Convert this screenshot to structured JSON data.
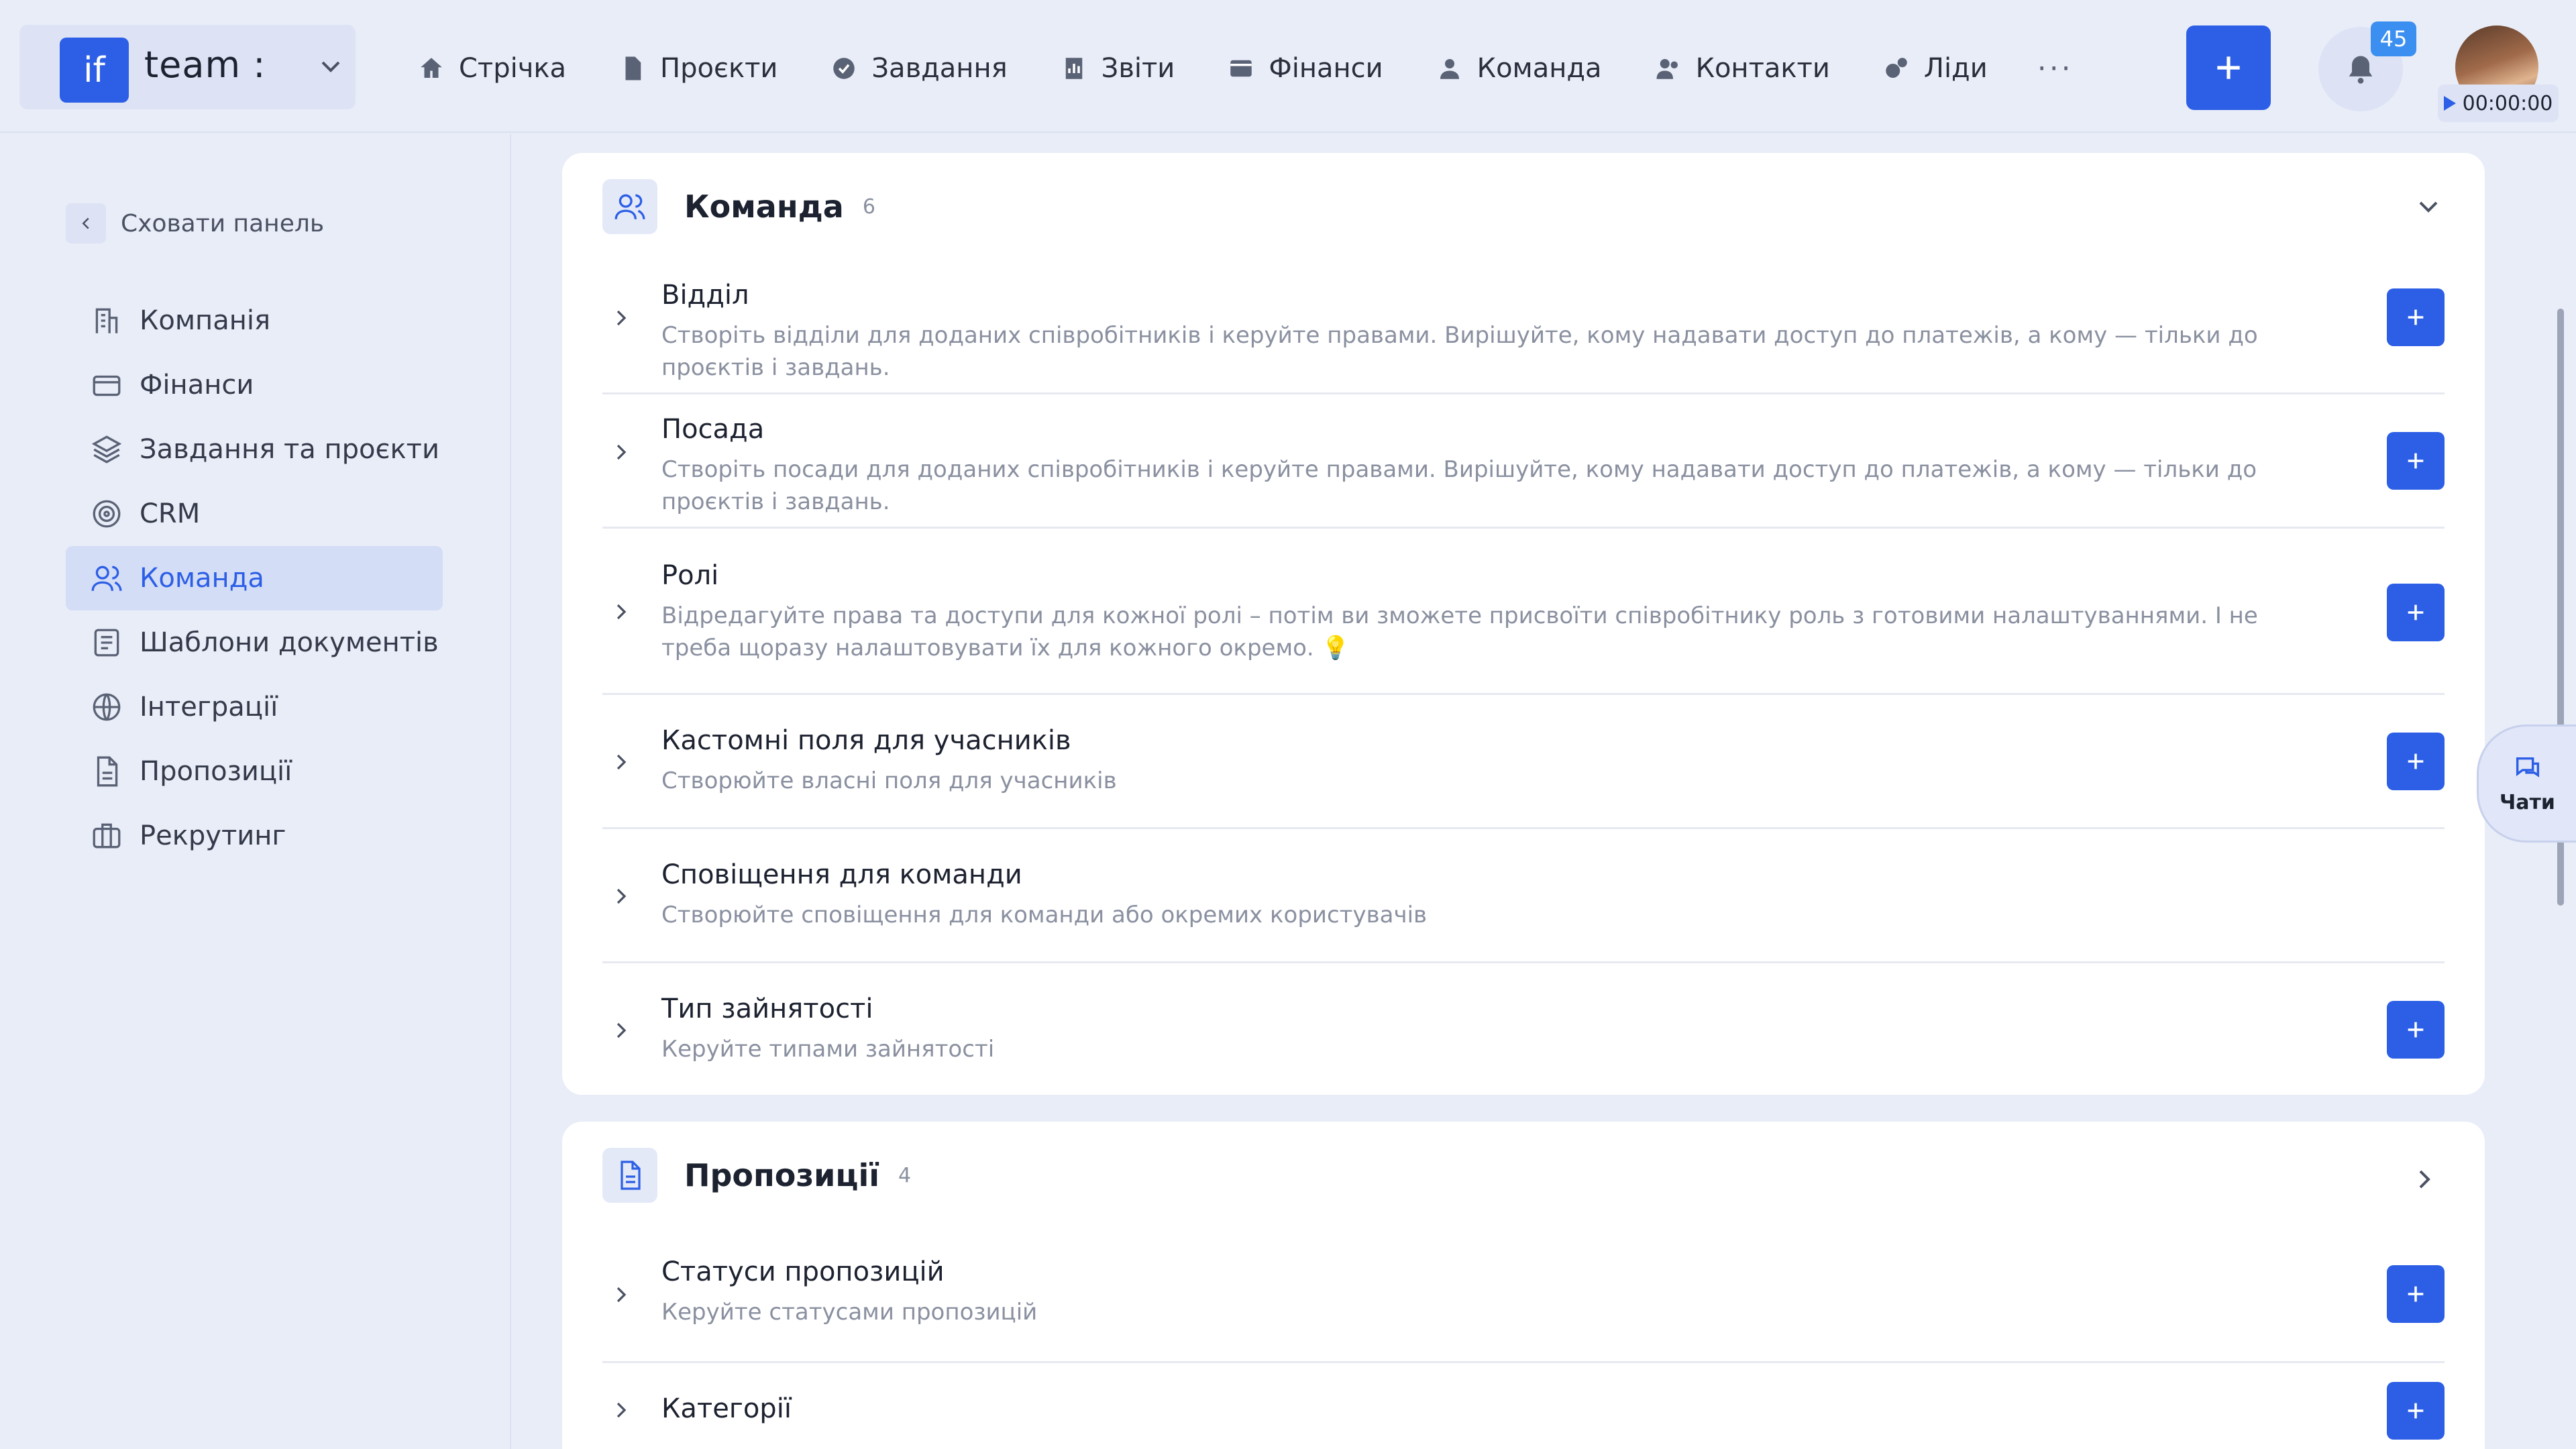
{
  "brand": {
    "logo": "if",
    "name": "team :"
  },
  "nav": {
    "items": [
      {
        "label": "Стрічка",
        "icon": "home-icon"
      },
      {
        "label": "Проєкти",
        "icon": "document-icon"
      },
      {
        "label": "Завдання",
        "icon": "check-circle-icon"
      },
      {
        "label": "Звіти",
        "icon": "chart-icon"
      },
      {
        "label": "Фінанси",
        "icon": "wallet-icon"
      },
      {
        "label": "Команда",
        "icon": "user-icon"
      },
      {
        "label": "Контакти",
        "icon": "users-icon"
      },
      {
        "label": "Ліди",
        "icon": "leads-icon"
      }
    ],
    "more": "···"
  },
  "header": {
    "add_label": "+",
    "notifications_count": "45",
    "timer": "00:00:00"
  },
  "sidebar": {
    "collapse_label": "Сховати панель",
    "items": [
      {
        "label": "Компанія",
        "icon": "company-icon"
      },
      {
        "label": "Фінанси",
        "icon": "card-icon"
      },
      {
        "label": "Завдання та проєкти",
        "icon": "layers-icon"
      },
      {
        "label": "CRM",
        "icon": "target-icon"
      },
      {
        "label": "Команда",
        "icon": "team-icon",
        "active": true
      },
      {
        "label": "Шаблони документів",
        "icon": "template-icon"
      },
      {
        "label": "Інтеграції",
        "icon": "globe-icon"
      },
      {
        "label": "Пропозиції",
        "icon": "file-icon"
      },
      {
        "label": "Рекрутинг",
        "icon": "briefcase-icon"
      }
    ]
  },
  "sections": [
    {
      "title": "Команда",
      "count": "6",
      "rows": [
        {
          "title": "Відділ",
          "desc": "Створіть відділи для доданих співробітників і керуйте правами. Вирішуйте, кому надавати доступ до платежів, а кому — тільки до проєктів і завдань.",
          "add": true
        },
        {
          "title": "Посада",
          "desc": "Створіть посади для доданих співробітників і керуйте правами. Вирішуйте, кому надавати доступ до платежів, а кому — тільки до проєктів і завдань.",
          "add": true
        },
        {
          "title": "Ролі",
          "desc": "Відредагуйте права та доступи для кожної ролі – потім ви зможете присвоїти співробітнику роль з готовими налаштуваннями. І не треба щоразу налаштовувати їх для кожного окремо. 💡",
          "add": true
        },
        {
          "title": "Кастомні поля для учасників",
          "desc": "Створюйте власні поля для учасників",
          "add": true
        },
        {
          "title": "Сповіщення для команди",
          "desc": "Створюйте сповіщення для команди або окремих користувачів",
          "add": false
        },
        {
          "title": "Тип зайнятості",
          "desc": "Керуйте типами зайнятості",
          "add": true
        }
      ]
    },
    {
      "title": "Пропозиції",
      "count": "4",
      "rows": [
        {
          "title": "Статуси пропозицій",
          "desc": "Керуйте статусами пропозицій",
          "add": true
        },
        {
          "title": "Категорії",
          "desc": "",
          "add": true
        }
      ]
    }
  ],
  "chats": {
    "label": "Чати"
  },
  "colors": {
    "accent": "#2c5fe6",
    "background": "#e9edf8",
    "badge": "#3b8ff0"
  }
}
